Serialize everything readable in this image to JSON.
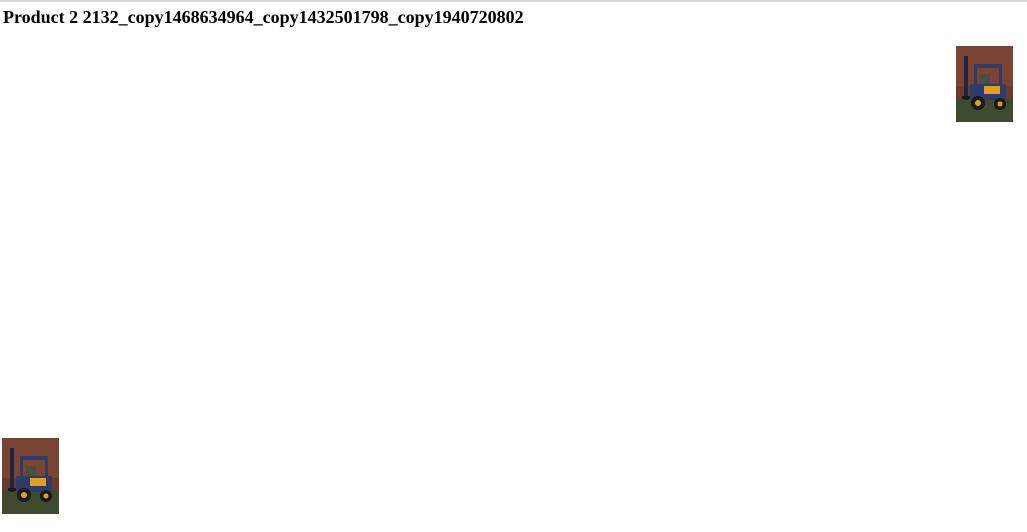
{
  "product": {
    "title": "Product 2 2132_copy1468634964_copy1432501798_copy1940720802",
    "images": [
      {
        "id": "image-top-right",
        "icon": "forklift-photo"
      },
      {
        "id": "image-bottom-left",
        "icon": "forklift-photo"
      }
    ]
  },
  "colors": {
    "wall": "#6b3a2c",
    "floor": "#3f4a2e",
    "forklift_body": "#2f3b6b",
    "forklift_accent": "#e0a020"
  }
}
